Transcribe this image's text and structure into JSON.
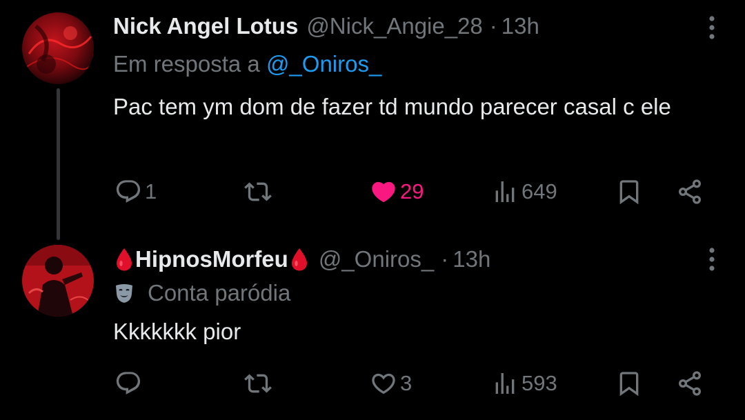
{
  "colors": {
    "background": "#000000",
    "text_primary": "#e7e9ea",
    "text_secondary": "#71767b",
    "mention": "#1d9bf0",
    "like_active": "#f91880",
    "drop_emoji": "#e0102a"
  },
  "tweets": [
    {
      "author": {
        "display_name": "Nick Angel Lotus",
        "handle": "@Nick_Angie_28",
        "avatar_icon": "red-abstract-avatar"
      },
      "time": "13h",
      "dot": "·",
      "reply_to": {
        "prefix": "Em resposta a",
        "mention": "@_Oniros_"
      },
      "text": "Pac tem ym dom de fazer td mundo parecer casal c ele",
      "actions": {
        "replies": "1",
        "retweets": "",
        "likes": "29",
        "liked": true,
        "views": "649"
      }
    },
    {
      "author": {
        "display_name": "HipnosMorfeu",
        "handle": "@_Oniros_",
        "avatar_icon": "red-person-avatar",
        "name_emoji": "drop-of-blood-icon"
      },
      "time": "13h",
      "dot": "·",
      "badge": {
        "icon": "performing-arts-mask-icon",
        "label": "Conta paródia"
      },
      "text": "Kkkkkkk pior",
      "actions": {
        "replies": "",
        "retweets": "",
        "likes": "3",
        "liked": false,
        "views": "593"
      }
    }
  ]
}
